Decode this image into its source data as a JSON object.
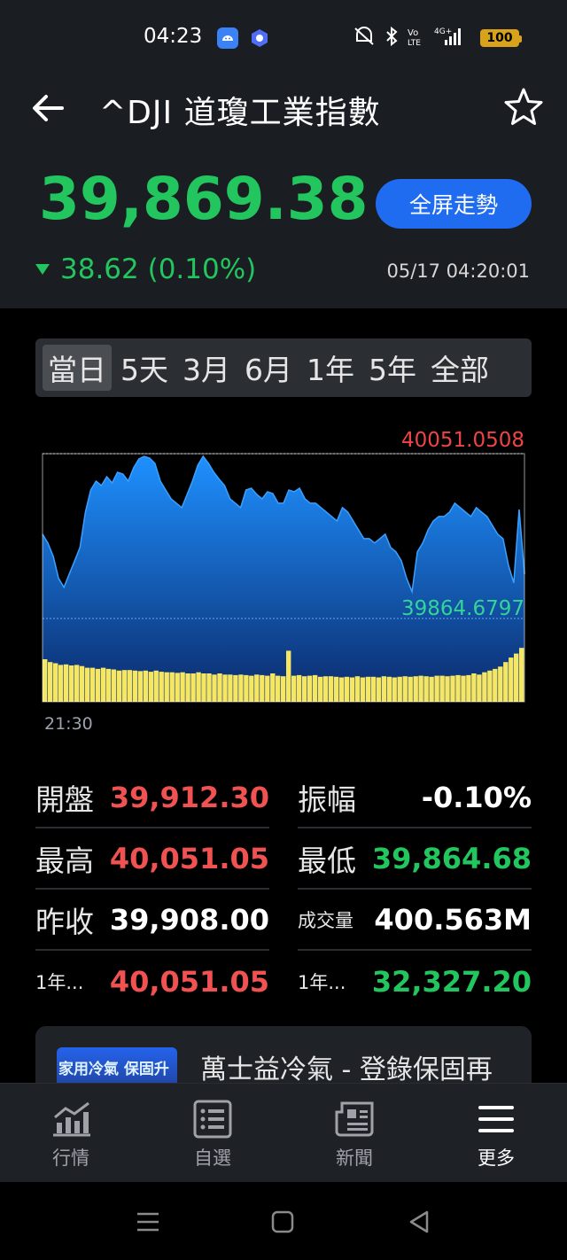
{
  "status_bar": {
    "time": "04:23",
    "network": "4G+",
    "battery": "100"
  },
  "header": {
    "title": "^DJI 道瓊工業指數",
    "price": "39,869.38",
    "fullscreen_label": "全屏走勢",
    "change": "38.62 (0.10%)",
    "direction": "down",
    "timestamp": "05/17 04:20:01"
  },
  "tabs": [
    {
      "label": "當日",
      "active": true
    },
    {
      "label": "5天",
      "active": false
    },
    {
      "label": "3月",
      "active": false
    },
    {
      "label": "6月",
      "active": false
    },
    {
      "label": "1年",
      "active": false
    },
    {
      "label": "5年",
      "active": false
    },
    {
      "label": "全部",
      "active": false
    }
  ],
  "chart": {
    "high_label": "40051.0508",
    "low_label": "39864.6797",
    "start_time": "21:30"
  },
  "chart_data": {
    "type": "area",
    "ylim": [
      39864.6797,
      40051.0508
    ],
    "x_start": "21:30",
    "series": [
      {
        "values": [
          39960,
          39950,
          39935,
          39910,
          39900,
          39915,
          39930,
          39945,
          39985,
          40010,
          40020,
          40015,
          40025,
          40018,
          40030,
          40028,
          40020,
          40035,
          40045,
          40048,
          40046,
          40040,
          40020,
          40010,
          40000,
          39995,
          39990,
          40005,
          40020,
          40038,
          40048,
          40040,
          40030,
          40022,
          40015,
          40000,
          39995,
          39990,
          40010,
          40012,
          40005,
          40000,
          40008,
          40006,
          39995,
          39995,
          40010,
          40008,
          40012,
          40000,
          39995,
          39995,
          39990,
          39985,
          39980,
          39975,
          39990,
          39985,
          39975,
          39965,
          39955,
          39955,
          39950,
          39955,
          39960,
          39945,
          39940,
          39930,
          39910,
          39895,
          39940,
          39950,
          39965,
          39975,
          39980,
          39980,
          39985,
          39995,
          39990,
          39985,
          39980,
          39990,
          39985,
          39980,
          39970,
          39960,
          39955,
          39925,
          39905,
          39988,
          39915
        ]
      }
    ],
    "volume": [
      0.75,
      0.7,
      0.68,
      0.65,
      0.66,
      0.64,
      0.65,
      0.63,
      0.6,
      0.6,
      0.58,
      0.6,
      0.58,
      0.57,
      0.55,
      0.56,
      0.56,
      0.55,
      0.54,
      0.55,
      0.53,
      0.55,
      0.53,
      0.52,
      0.52,
      0.51,
      0.52,
      0.5,
      0.5,
      0.52,
      0.5,
      0.5,
      0.48,
      0.5,
      0.48,
      0.48,
      0.47,
      0.48,
      0.47,
      0.46,
      0.48,
      0.47,
      0.46,
      0.5,
      0.46,
      0.45,
      0.9,
      0.46,
      0.47,
      0.45,
      0.46,
      0.47,
      0.44,
      0.45,
      0.45,
      0.44,
      0.43,
      0.44,
      0.43,
      0.45,
      0.43,
      0.44,
      0.44,
      0.43,
      0.45,
      0.44,
      0.43,
      0.44,
      0.45,
      0.44,
      0.45,
      0.46,
      0.45,
      0.44,
      0.46,
      0.46,
      0.45,
      0.46,
      0.47,
      0.46,
      0.47,
      0.5,
      0.48,
      0.52,
      0.55,
      0.58,
      0.62,
      0.7,
      0.78,
      0.85,
      0.95
    ]
  },
  "stats": [
    {
      "label": "開盤",
      "value": "39,912.30",
      "color": "red",
      "small": false
    },
    {
      "label": "振幅",
      "value": "-0.10%",
      "color": "white",
      "small": false
    },
    {
      "label": "最高",
      "value": "40,051.05",
      "color": "red",
      "small": false
    },
    {
      "label": "最低",
      "value": "39,864.68",
      "color": "green",
      "small": false
    },
    {
      "label": "昨收",
      "value": "39,908.00",
      "color": "white",
      "small": false
    },
    {
      "label": "成交量",
      "value": "400.563M",
      "color": "white",
      "small": true
    },
    {
      "label": "1年...",
      "value": "40,051.05",
      "color": "red",
      "small": true
    },
    {
      "label": "1年...",
      "value": "32,327.20",
      "color": "green",
      "small": true
    }
  ],
  "ad": {
    "thumb_text": "家用冷氣 保固升",
    "text": "萬士益冷氣 - 登錄保固再"
  },
  "bottom_nav": [
    {
      "label": "行情",
      "icon": "chart-icon",
      "active": false
    },
    {
      "label": "自選",
      "icon": "list-icon",
      "active": false
    },
    {
      "label": "新聞",
      "icon": "news-icon",
      "active": false
    },
    {
      "label": "更多",
      "icon": "menu-icon",
      "active": true
    }
  ],
  "colors": {
    "up": "#f05252",
    "down": "#22c55e",
    "accent": "#1f6cf0"
  }
}
